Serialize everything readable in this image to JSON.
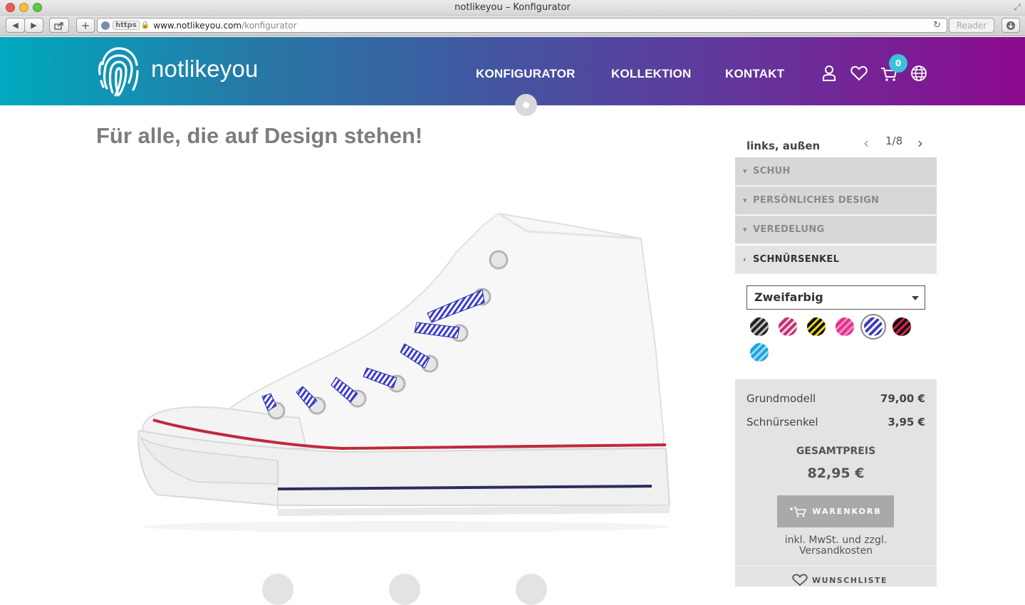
{
  "browser": {
    "window_title": "notlikeyou – Konfigurator",
    "https_label": "https",
    "url_host": "www.notlikeyou.com",
    "url_path": "/konfigurator",
    "reader_label": "Reader"
  },
  "header": {
    "logo_text": "notlikeyou",
    "nav": [
      "KONFIGURATOR",
      "KOLLEKTION",
      "KONTAKT"
    ],
    "cart_count": "0",
    "icons": [
      "user-icon",
      "heart-icon",
      "cart-icon",
      "globe-icon"
    ],
    "gradient": [
      "#00a9bf",
      "#8c0a8e"
    ]
  },
  "main": {
    "headline": "Für alle, die auf Design stehen!"
  },
  "configurator": {
    "position_label": "links, außen",
    "pager": "1/8",
    "sections": [
      {
        "label": "SCHUH",
        "expanded": false
      },
      {
        "label": "PERSÖNLICHES DESIGN",
        "expanded": false
      },
      {
        "label": "VEREDELUNG",
        "expanded": false
      },
      {
        "label": "SCHNÜRSENKEL",
        "expanded": true
      }
    ],
    "lace_type_selected": "Zweifarbig",
    "swatches": [
      {
        "colors": [
          "#222222",
          "#bbbbbb"
        ],
        "selected": false
      },
      {
        "colors": [
          "#c0306e",
          "#f3d0e0"
        ],
        "selected": false
      },
      {
        "colors": [
          "#111111",
          "#f2d21c"
        ],
        "selected": false
      },
      {
        "colors": [
          "#e0328a",
          "#f58cc4"
        ],
        "selected": false
      },
      {
        "colors": [
          "#3b3bb8",
          "#ffffff"
        ],
        "selected": true
      },
      {
        "colors": [
          "#111111",
          "#d8204a"
        ],
        "selected": false
      },
      {
        "colors": [
          "#1aa3dd",
          "#9ad9f3"
        ],
        "selected": false
      }
    ]
  },
  "pricing": {
    "rows": [
      {
        "label": "Grundmodell",
        "value": "79,00 €"
      },
      {
        "label": "Schnürsenkel",
        "value": "3,95 €"
      }
    ],
    "total_label": "GESAMTPREIS",
    "total_value": "82,95 €",
    "cart_button": "WARENKORB",
    "tax_note": "inkl. MwSt. und zzgl. Versandkosten",
    "wishlist_button": "WUNSCHLISTE"
  }
}
